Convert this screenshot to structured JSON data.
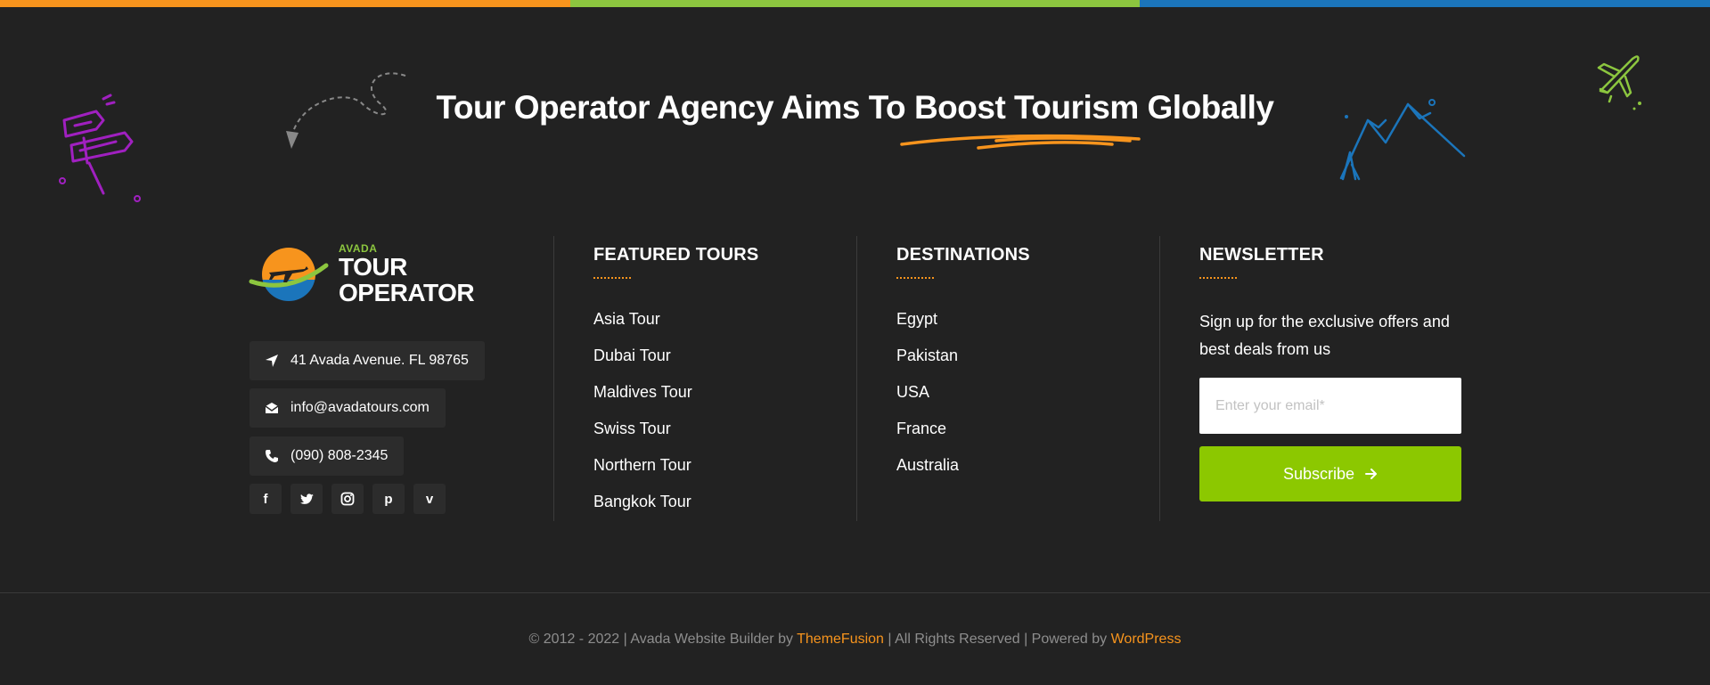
{
  "colors": {
    "stripe": [
      "#f7941d",
      "#8cc63f",
      "#1b75bb"
    ],
    "accent_orange": "#f7941d",
    "accent_green": "#8cc800",
    "background": "#222222"
  },
  "hero": {
    "headline": "Tour Operator Agency Aims To Boost Tourism Globally"
  },
  "brand": {
    "small": "AVADA",
    "line1": "TOUR",
    "line2": "OPERATOR"
  },
  "contact": {
    "address": "41 Avada Avenue. FL 98765",
    "email": "info@avadatours.com",
    "phone": "(090) 808-2345"
  },
  "social": [
    {
      "icon": "facebook-icon",
      "glyph": "f"
    },
    {
      "icon": "twitter-icon",
      "glyph": "t"
    },
    {
      "icon": "instagram-icon",
      "glyph": "◎"
    },
    {
      "icon": "pinterest-icon",
      "glyph": "p"
    },
    {
      "icon": "vimeo-icon",
      "glyph": "v"
    }
  ],
  "featured": {
    "title": "FEATURED TOURS",
    "items": [
      "Asia Tour",
      "Dubai Tour",
      "Maldives Tour",
      "Swiss Tour",
      "Northern Tour",
      "Bangkok Tour"
    ]
  },
  "destinations": {
    "title": "DESTINATIONS",
    "items": [
      "Egypt",
      "Pakistan",
      "USA",
      "France",
      "Australia"
    ]
  },
  "newsletter": {
    "title": "NEWSLETTER",
    "text": "Sign up for the exclusive offers and best deals from us",
    "placeholder": "Enter your email*",
    "button": "Subscribe"
  },
  "footer": {
    "prefix": "© 2012 - 2022 | Avada Website Builder by ",
    "link1": "ThemeFusion",
    "middle": " | All Rights Reserved | Powered by ",
    "link2": "WordPress"
  }
}
